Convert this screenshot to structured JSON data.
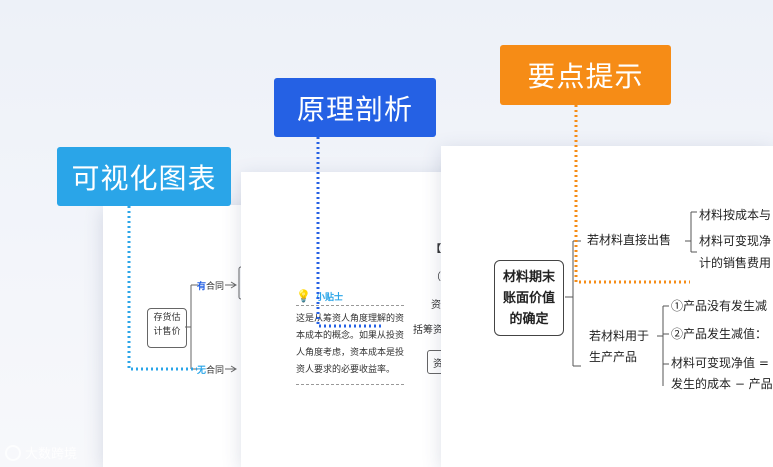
{
  "labels": {
    "visual": "可视化图表",
    "principle": "原理剖析",
    "key_points": "要点提示"
  },
  "page1": {
    "center_box": "存货估\n计售价",
    "branch_top_prefix": "有",
    "branch_top_suffix": "合同",
    "branch_bottom_prefix": "无",
    "branch_bottom_suffix": "合同"
  },
  "page2": {
    "tip_title": "小贴士",
    "tip_lines": [
      "这是从筹资人角度理解的资",
      "本成本的概念。如果从投资",
      "人角度考虑，资本成本是投",
      "资人要求的必要收益率。"
    ],
    "side_chars": [
      "【",
      "（",
      "资",
      "括筹资"
    ],
    "side_button": "资"
  },
  "page3": {
    "main_box": [
      "材料期末",
      "账面价值",
      "的确定"
    ],
    "branch1": "若材料直接出售",
    "branch1_items": [
      "材料按成本与",
      "材料可变现净",
      "计的销售费用"
    ],
    "branch2_line1": "若材料用于",
    "branch2_line2": "生产产品",
    "branch2_items": [
      "①产品没有发生减",
      "②产品发生减值：",
      "材料可变现净值 =",
      "发生的成本 − 产品"
    ]
  },
  "watermark": "大数跨境",
  "colors": {
    "visual": "#2aa5e8",
    "principle": "#2561e4",
    "key_points": "#f68c16",
    "top_branch": "#2561e4",
    "bottom_branch": "#2aa5e8"
  }
}
